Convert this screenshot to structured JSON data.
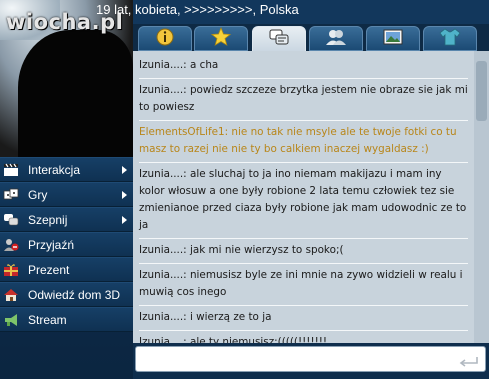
{
  "profile": {
    "title": "19 lat, kobieta, >>>>>>>>>, Polska",
    "watermark": "wiocha.pl"
  },
  "menu": {
    "items": [
      {
        "label": "Interakcja",
        "icon": "clapperboard-icon",
        "has_submenu": true
      },
      {
        "label": "Gry",
        "icon": "dice-icon",
        "has_submenu": true
      },
      {
        "label": "Szepnij",
        "icon": "whisper-bubble-icon",
        "has_submenu": true
      },
      {
        "label": "Przyjaźń",
        "icon": "friend-icon",
        "has_submenu": false
      },
      {
        "label": "Prezent",
        "icon": "gift-icon",
        "has_submenu": false
      },
      {
        "label": "Odwiedź dom 3D",
        "icon": "house-icon",
        "has_submenu": false
      },
      {
        "label": "Stream",
        "icon": "megaphone-icon",
        "has_submenu": false
      }
    ]
  },
  "tabs": [
    {
      "icon": "info-icon",
      "active": false
    },
    {
      "icon": "star-icon",
      "active": false
    },
    {
      "icon": "chat-icon",
      "active": true
    },
    {
      "icon": "users-icon",
      "active": false
    },
    {
      "icon": "photo-icon",
      "active": false
    },
    {
      "icon": "tshirt-icon",
      "active": false
    }
  ],
  "chat": {
    "messages": [
      {
        "text": "Izunia....: a cha",
        "type": "normal"
      },
      {
        "text": "Izunia....: powiedz szczeze brzytka jestem nie obraze sie jak mi to powiesz",
        "type": "normal"
      },
      {
        "text": "ElementsOfLife1: nie no tak nie msyle ale te twoje fotki co tu masz to razej nie nie ty bo calkiem inaczej wygaldasz :)",
        "type": "alt"
      },
      {
        "text": "Izunia....: ale sluchaj to ja ino niemam makijazu i mam iny kolor włosuw a one były robione 2 lata temu człowiek tez sie zmienianoe przed ciaza były robione jak mam udowodnic ze to ja",
        "type": "normal"
      },
      {
        "text": "Izunia....: jak mi nie wierzysz to spoko;(",
        "type": "normal"
      },
      {
        "text": "Izunia....: niemusisz byle ze ini mnie na zywo widzieli w realu i muwią cos inego",
        "type": "normal"
      },
      {
        "text": "Izunia....: i wierzą ze to ja",
        "type": "normal"
      },
      {
        "text": "Izunia....: ale ty niemusisz:(((((!!!!!!!",
        "type": "normal"
      }
    ]
  },
  "input": {
    "value": "",
    "placeholder": ""
  },
  "colors": {
    "alt_message": "#b8861a",
    "panel_bg": "#c8d3dc",
    "sidebar_bg": "#12385e"
  }
}
